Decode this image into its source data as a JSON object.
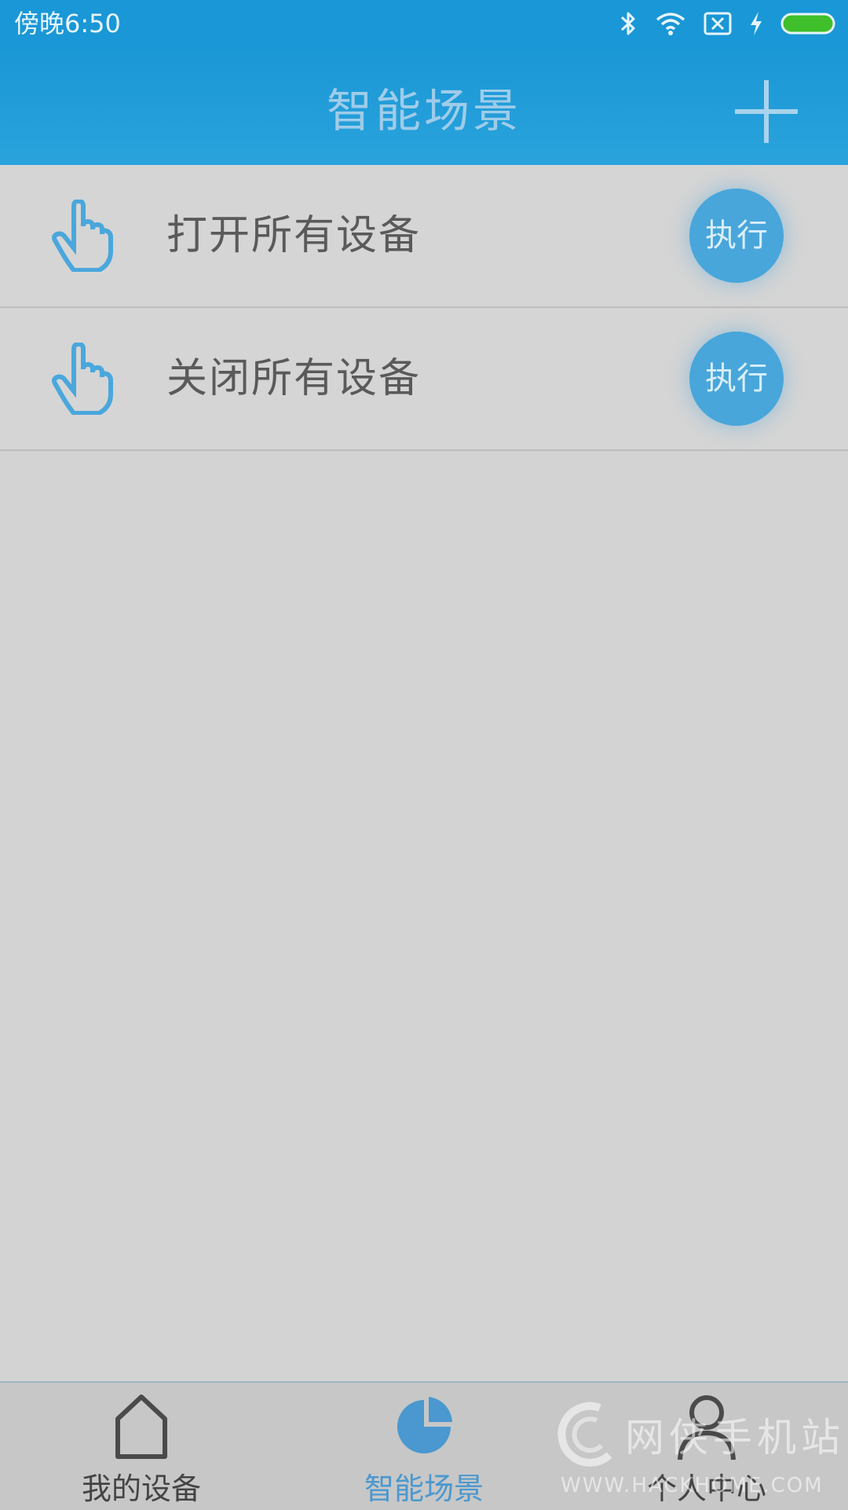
{
  "status_bar": {
    "time": "傍晚6:50",
    "icons": [
      "bluetooth-icon",
      "wifi-icon",
      "no-sim-icon",
      "charging-icon",
      "battery-icon"
    ],
    "battery_color": "#3fbf2a"
  },
  "header": {
    "title": "智能场景",
    "add_icon": "plus-icon",
    "background": "#1a97d6"
  },
  "scenes": [
    {
      "icon": "pointing-hand-icon",
      "label": "打开所有设备",
      "action": "执行"
    },
    {
      "icon": "pointing-hand-icon",
      "label": "关闭所有设备",
      "action": "执行"
    }
  ],
  "tab_bar": {
    "tabs": [
      {
        "icon": "house-icon",
        "label": "我的设备",
        "active": false
      },
      {
        "icon": "pie-chart-icon",
        "label": "智能场景",
        "active": true
      },
      {
        "icon": "person-icon",
        "label": "个人中心",
        "active": false
      }
    ],
    "active_color": "#4a98cf"
  },
  "watermark": {
    "title": "网侠手机站",
    "url": "WWW.HACKHOME.COM"
  }
}
